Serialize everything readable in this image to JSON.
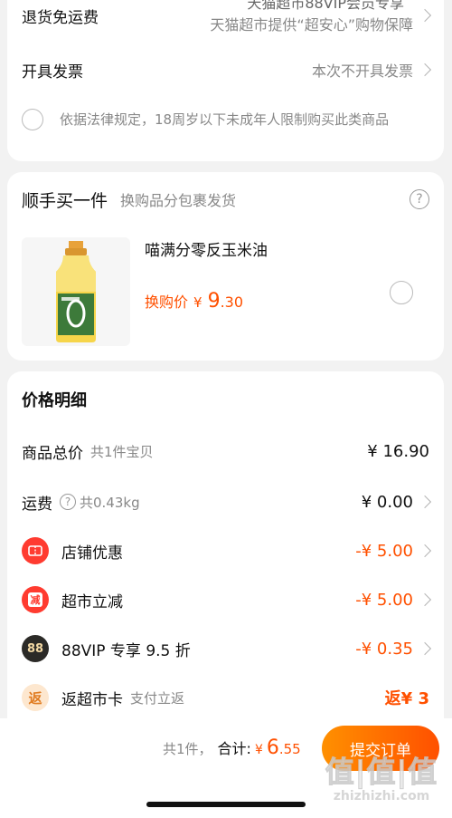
{
  "colors": {
    "accent": "#ff5000",
    "bg": "#f2f2f2",
    "muted": "#888888",
    "submit_gradient": [
      "#ff9000",
      "#ff5000"
    ]
  },
  "service_card": {
    "partial_line1": "天猫超市88VIP会员专享",
    "return_shipping": {
      "label": "退货免运费",
      "value": "天猫超市提供“超安心”购物保障"
    },
    "invoice": {
      "label": "开具发票",
      "value": "本次不开具发票"
    },
    "age_notice": "依据法律规定，18周岁以下未成年人限制购买此类商品"
  },
  "addon_card": {
    "title": "顺手买一件",
    "subtitle": "换购品分包裹发货",
    "help_icon": "question-circle-icon",
    "product": {
      "name": "喵满分零反玉米油",
      "price_label": "换购价",
      "currency": "¥",
      "price_int": "9",
      "price_dec": ".30",
      "image_icon": "oil-bottle"
    }
  },
  "price_card": {
    "title": "价格明细",
    "rows": [
      {
        "label": "商品总价",
        "sub": "共1件宝贝",
        "value": "¥ 16.90"
      },
      {
        "label": "运费",
        "sub": "共0.43kg",
        "value": "¥ 0.00"
      },
      {
        "label": "店铺优惠",
        "value": "-¥ 5.00",
        "icon": "coupon-icon"
      },
      {
        "label": "超市立减",
        "value": "-¥ 5.00",
        "icon": "discount-icon",
        "icon_text": "减"
      },
      {
        "label": "88VIP 专享 9.5 折",
        "value": "-¥ 0.35",
        "icon": "vip88-icon",
        "icon_text": "88"
      },
      {
        "label": "返超市卡",
        "sub": "支付立返",
        "value": "返¥ 3",
        "icon": "rebate-icon",
        "icon_text": "返"
      }
    ]
  },
  "footer": {
    "count": "共1件，",
    "total_label": "合计:",
    "currency": "¥",
    "total_int": "6",
    "total_dec": ".55",
    "submit": "提交订单",
    "watermark": "值|值|值",
    "watermark_url": "zhizhizhi.com"
  }
}
